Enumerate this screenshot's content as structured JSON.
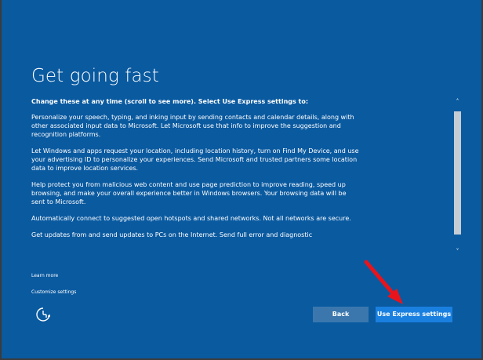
{
  "title": "Get going fast",
  "subtitle": "Change these at any time (scroll to see more). Select Use Express settings to:",
  "paragraphs": [
    "Personalize your speech, typing, and inking input by sending contacts and calendar details, along with other associated input data to Microsoft. Let Microsoft use that info to improve the suggestion and recognition platforms.",
    "Let Windows and apps request your location, including location history, turn on Find My Device, and use your advertising ID to personalize your experiences. Send Microsoft and trusted partners some location data to improve location services.",
    "Help protect you from malicious web content and use page prediction to improve reading, speed up browsing, and make your overall experience better in Windows browsers. Your browsing data will be sent to Microsoft.",
    "Automatically connect to suggested open hotspots and shared networks. Not all networks are secure.",
    "Get updates from and send updates to PCs on the Internet. Send full error and diagnostic"
  ],
  "scrollbar": {
    "up_arrow": "˄",
    "down_arrow": "˅"
  },
  "links": {
    "learn_more": "Learn more",
    "customize": "Customize settings"
  },
  "buttons": {
    "back": "Back",
    "express": "Use Express settings"
  },
  "icons": {
    "ease_of_access": "ease-of-access-icon",
    "annotation_arrow": "red-arrow-annotation"
  },
  "colors": {
    "background": "#0a5aa0",
    "primary_button": "#1a80e0",
    "secondary_button": "#3b77ad",
    "annotation": "#e8141c"
  }
}
